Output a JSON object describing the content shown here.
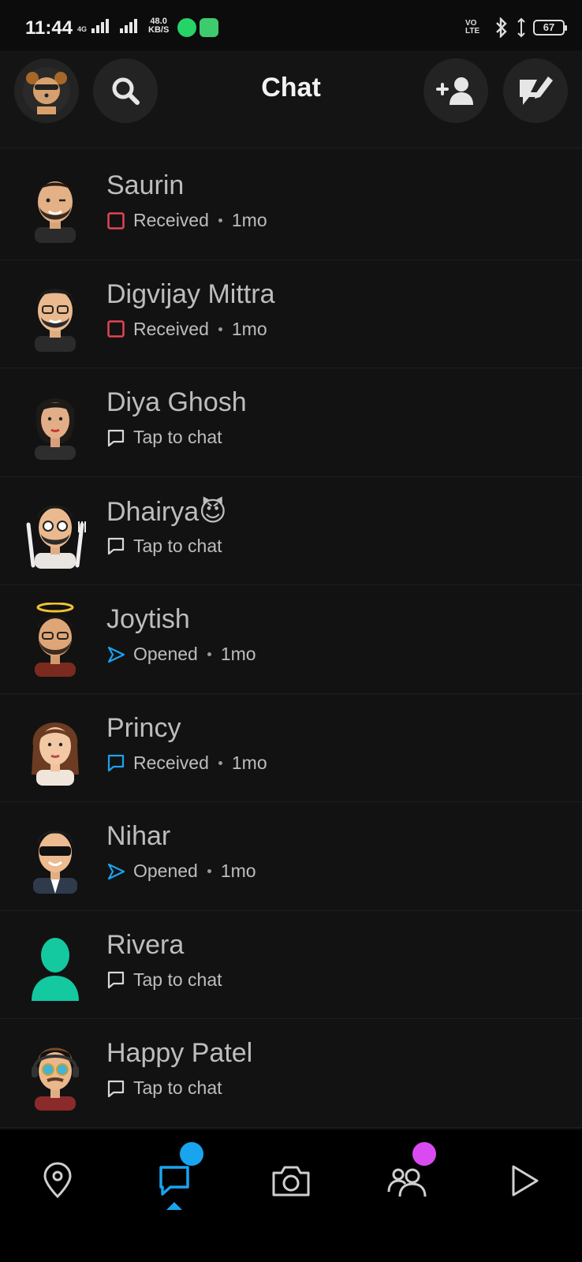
{
  "status_bar": {
    "time": "11:44",
    "network_tag": "4G",
    "speed_value": "48.0",
    "speed_unit": "KB/S",
    "volte": "VO LTE",
    "battery": "67"
  },
  "header": {
    "title": "Chat"
  },
  "colors": {
    "accent_blue": "#19a4ef",
    "received_red": "#e24552",
    "story_purple": "#d94bf0",
    "background": "#121212"
  },
  "chats": [
    {
      "name": "Saurin",
      "status": "Received",
      "time": "1mo",
      "icon": "red-square-icon"
    },
    {
      "name": "Digvijay Mittra",
      "status": "Received",
      "time": "1mo",
      "icon": "red-square-icon"
    },
    {
      "name": "Diya Ghosh",
      "status": "Tap to chat",
      "time": "",
      "icon": "chat-bubble-icon"
    },
    {
      "name": "Dhairya😈",
      "status": "Tap to chat",
      "time": "",
      "icon": "chat-bubble-icon"
    },
    {
      "name": "Joytish",
      "status": "Opened",
      "time": "1mo",
      "icon": "blue-arrow-icon"
    },
    {
      "name": "Princy",
      "status": "Received",
      "time": "1mo",
      "icon": "blue-chat-bubble-icon"
    },
    {
      "name": "Nihar",
      "status": "Opened",
      "time": "1mo",
      "icon": "blue-arrow-icon"
    },
    {
      "name": "Rivera",
      "status": "Tap to chat",
      "time": "",
      "icon": "chat-bubble-icon"
    },
    {
      "name": "Happy Patel",
      "status": "Tap to chat",
      "time": "",
      "icon": "chat-bubble-icon"
    }
  ],
  "bottom_nav": [
    {
      "icon": "map-pin-icon"
    },
    {
      "icon": "chat-icon",
      "active": true
    },
    {
      "icon": "camera-icon"
    },
    {
      "icon": "friends-icon"
    },
    {
      "icon": "play-icon"
    }
  ]
}
